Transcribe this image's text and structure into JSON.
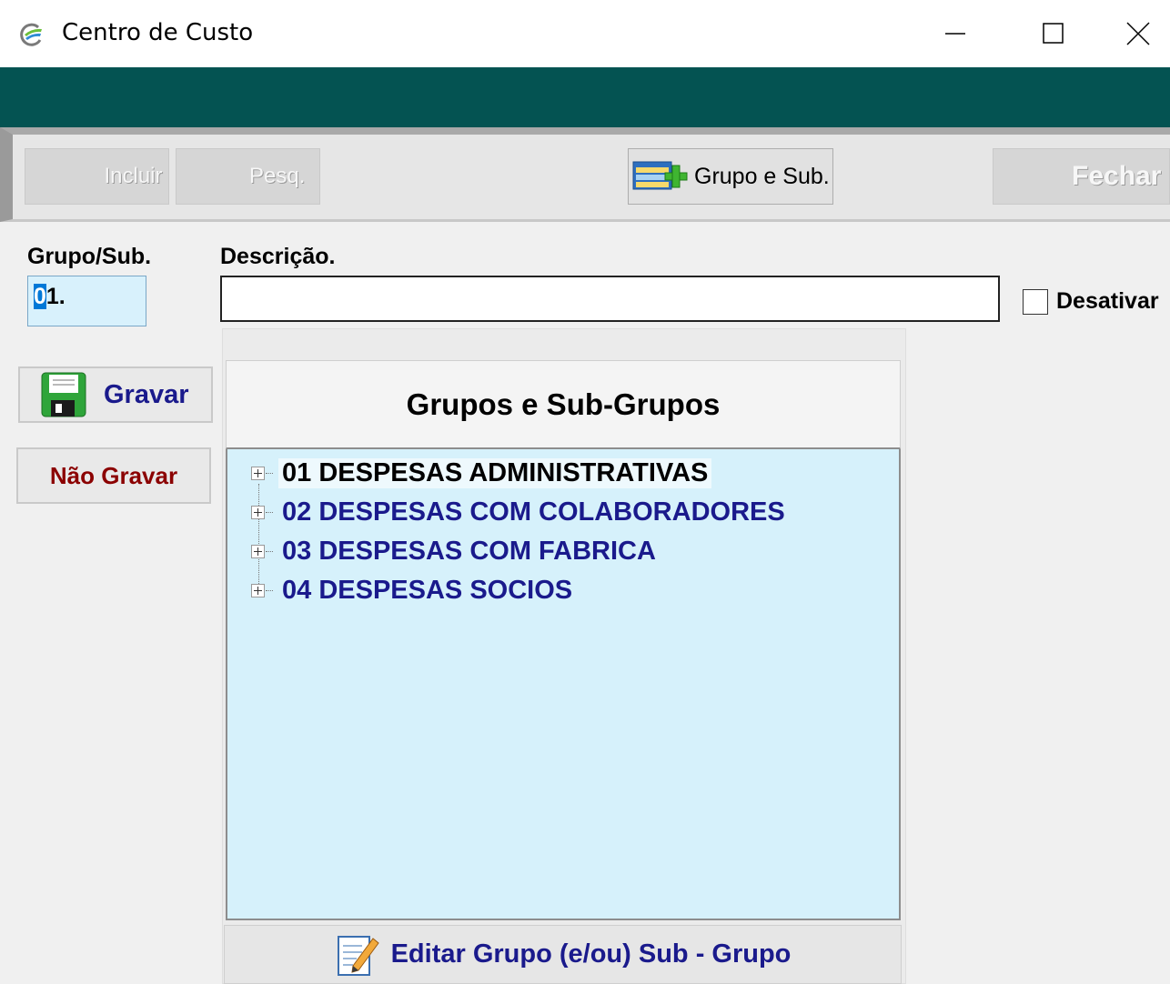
{
  "window": {
    "title": "Centro de Custo",
    "controls": [
      "minimize",
      "maximize",
      "close"
    ]
  },
  "toolbar": {
    "incluir_label": "Incluir",
    "pesq_label": "Pesq.",
    "grupo_label": "Grupo e Sub.",
    "fechar_label": "Fechar"
  },
  "form": {
    "grupo_label": "Grupo/Sub.",
    "grupo_value_selected": "0",
    "grupo_value_rest": "1.",
    "descricao_label": "Descrição.",
    "descricao_value": "",
    "desativar_label": "Desativar",
    "desativar_checked": false
  },
  "actions": {
    "gravar_label": "Gravar",
    "nao_gravar_label": "Não Gravar"
  },
  "tree_panel": {
    "title": "Grupos e Sub-Grupos",
    "items": [
      {
        "label": "01 DESPESAS ADMINISTRATIVAS",
        "selected": true
      },
      {
        "label": "02 DESPESAS COM COLABORADORES",
        "selected": false
      },
      {
        "label": "03 DESPESAS COM FABRICA",
        "selected": false
      },
      {
        "label": "04 DESPESAS SOCIOS",
        "selected": false
      }
    ],
    "edit_label": "Editar Grupo (e/ou) Sub - Grupo"
  },
  "colors": {
    "teal_band": "#045352",
    "tree_bg": "#d6f1fb",
    "item_text": "#1a1a8c",
    "selected_text": "#000000",
    "nao_gravar_text": "#8b0000"
  }
}
